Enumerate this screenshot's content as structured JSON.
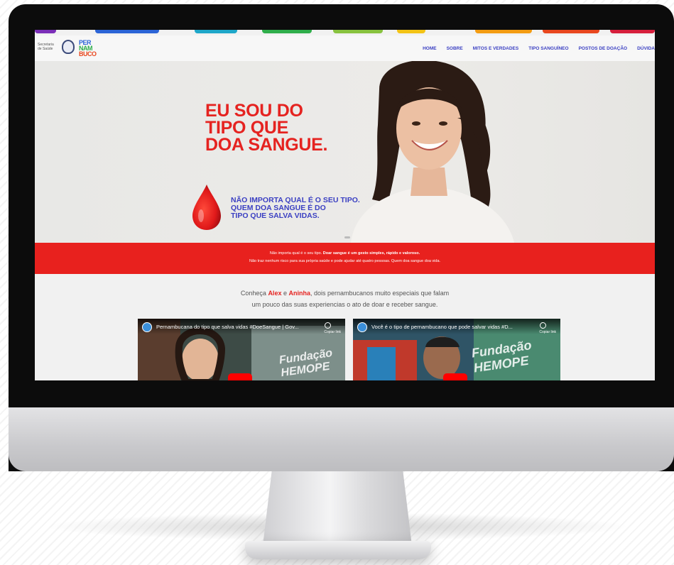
{
  "header": {
    "secretaria": "Secretaria de Saúde",
    "logo_lines": [
      "PER",
      "NAM",
      "BUCO"
    ],
    "nav": [
      "HOME",
      "SOBRE",
      "MITOS E VERDADES",
      "TIPO SANGUÍNEO",
      "POSTOS DE DOAÇÃO",
      "DÚVIDA"
    ]
  },
  "hero": {
    "headline": [
      "EU SOU DO",
      "TIPO QUE",
      "DOA SANGUE."
    ],
    "tagline": [
      "NÃO IMPORTA QUAL É O SEU TIPO.",
      "QUEM DOA SANGUE É DO",
      "TIPO QUE SALVA VIDAS."
    ]
  },
  "band": {
    "line1_a": "Não importa qual é o seu tipo. ",
    "line1_b": "Doar sangue é um gesto simples, rápido e valoroso.",
    "line2": "Não traz nenhum risco para sua própria saúde e pode ajudar até quatro pessoas. Quem doa sangue doa vida."
  },
  "intro": {
    "p1": "Conheça ",
    "name1": "Alex",
    "p2": " e ",
    "name2": "Aninha",
    "p3": ", dois pernambucanos muito especiais que falam",
    "line2": "um pouco das suas experiencias o ato de doar e receber sangue."
  },
  "videos": [
    {
      "title": "Pernambucana do tipo que salva vidas #DoeSangue | Gov...",
      "copy": "Copiar link",
      "sign": "Fundação HEMOPE"
    },
    {
      "title": "Você é o tipo de pernambucano que pode salvar vidas #D...",
      "copy": "Copiar link",
      "sign": "Fundação HEMOPE"
    }
  ],
  "colors": {
    "red": "#e52320",
    "blue": "#3a3fc2",
    "band_red": "#e8211e"
  }
}
